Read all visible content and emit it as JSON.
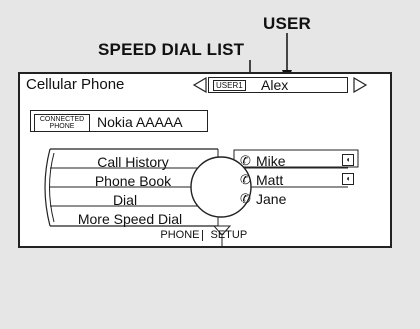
{
  "callouts": {
    "user": "USER",
    "speed_dial_list": "SPEED DIAL LIST"
  },
  "screen": {
    "title": "Cellular Phone",
    "user_selector": {
      "tag": "USER1",
      "name": "Alex"
    },
    "phone_status": {
      "badge_line1": "CONNECTED",
      "badge_line2": "PHONE",
      "phone_name": "Nokia AAAAA"
    },
    "menu": [
      {
        "label": "Call History"
      },
      {
        "label": "Phone Book"
      },
      {
        "label": "Dial"
      },
      {
        "label": "More Speed Dial"
      }
    ],
    "speed_dial": [
      {
        "label": "Mike",
        "icon": "handset-icon",
        "has_voice_tag": true
      },
      {
        "label": "Matt",
        "icon": "handset-icon",
        "has_voice_tag": true
      },
      {
        "label": "Jane",
        "icon": "handset-icon",
        "has_voice_tag": false
      }
    ],
    "footer": {
      "left": "PHONE",
      "right": "SETUP"
    }
  }
}
